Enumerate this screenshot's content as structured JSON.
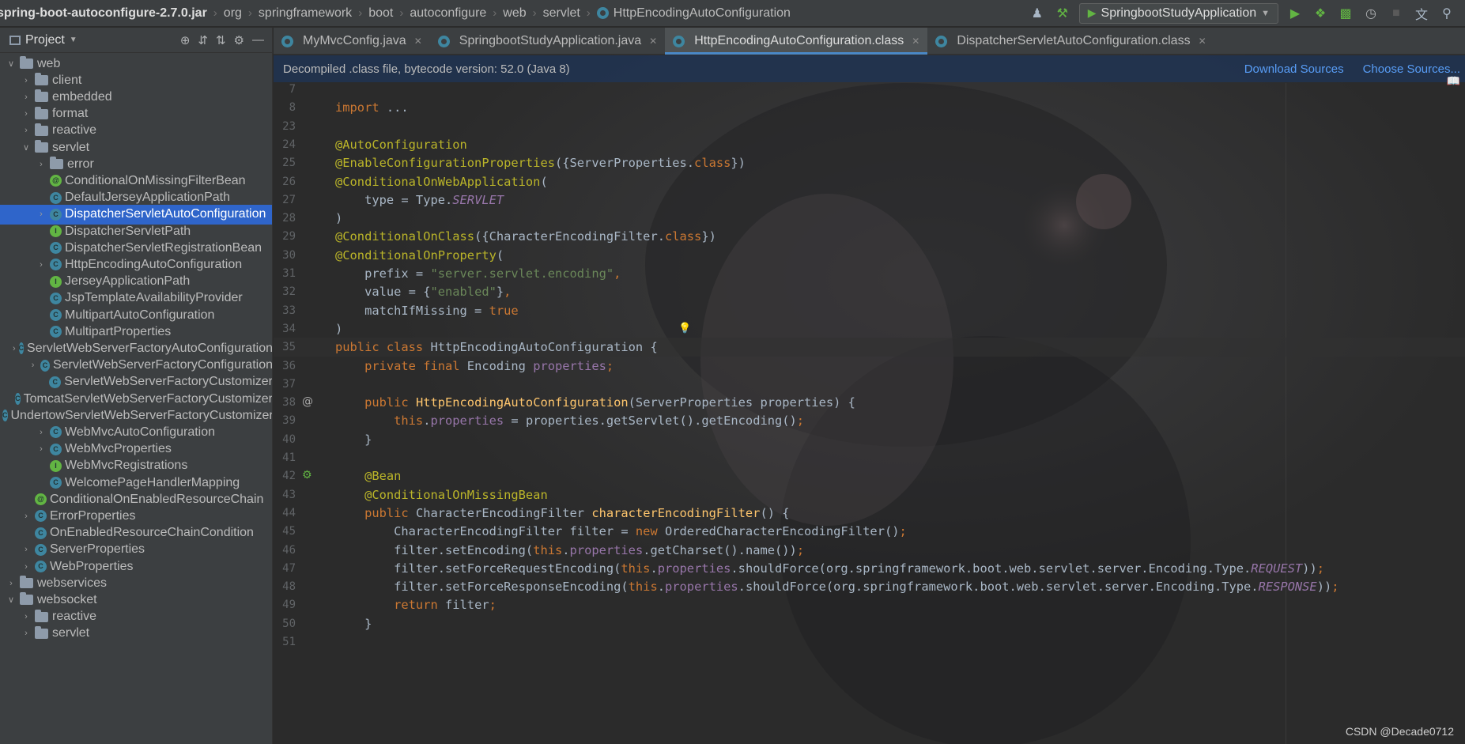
{
  "navbar": {
    "breadcrumb": [
      "spring-boot-autoconfigure-2.7.0.jar",
      "org",
      "springframework",
      "boot",
      "autoconfigure",
      "web",
      "servlet",
      "HttpEncodingAutoConfiguration"
    ],
    "run_config": "SpringbootStudyApplication",
    "icons": [
      "user-icon",
      "build-hammer-icon",
      "run-icon",
      "debug-icon",
      "coverage-icon",
      "profile-icon",
      "stop-icon",
      "translate-icon",
      "search-icon"
    ]
  },
  "project": {
    "title": "Project",
    "tree": [
      {
        "label": "web",
        "kind": "folder",
        "expanded": true
      },
      {
        "label": "client",
        "kind": "folder"
      },
      {
        "label": "embedded",
        "kind": "folder"
      },
      {
        "label": "format",
        "kind": "folder"
      },
      {
        "label": "reactive",
        "kind": "folder"
      },
      {
        "label": "servlet",
        "kind": "folder",
        "expanded": true
      },
      {
        "label": "error",
        "kind": "folder"
      },
      {
        "label": "ConditionalOnMissingFilterBean",
        "kind": "annotation"
      },
      {
        "label": "DefaultJerseyApplicationPath",
        "kind": "class"
      },
      {
        "label": "DispatcherServletAutoConfiguration",
        "kind": "class",
        "selected": true
      },
      {
        "label": "DispatcherServletPath",
        "kind": "interface"
      },
      {
        "label": "DispatcherServletRegistrationBean",
        "kind": "class"
      },
      {
        "label": "HttpEncodingAutoConfiguration",
        "kind": "class"
      },
      {
        "label": "JerseyApplicationPath",
        "kind": "interface"
      },
      {
        "label": "JspTemplateAvailabilityProvider",
        "kind": "class"
      },
      {
        "label": "MultipartAutoConfiguration",
        "kind": "class"
      },
      {
        "label": "MultipartProperties",
        "kind": "class"
      },
      {
        "label": "ServletWebServerFactoryAutoConfiguration",
        "kind": "class"
      },
      {
        "label": "ServletWebServerFactoryConfiguration",
        "kind": "class"
      },
      {
        "label": "ServletWebServerFactoryCustomizer",
        "kind": "class"
      },
      {
        "label": "TomcatServletWebServerFactoryCustomizer",
        "kind": "class"
      },
      {
        "label": "UndertowServletWebServerFactoryCustomizer",
        "kind": "class"
      },
      {
        "label": "WebMvcAutoConfiguration",
        "kind": "class"
      },
      {
        "label": "WebMvcProperties",
        "kind": "class"
      },
      {
        "label": "WebMvcRegistrations",
        "kind": "interface"
      },
      {
        "label": "WelcomePageHandlerMapping",
        "kind": "class"
      },
      {
        "label": "ConditionalOnEnabledResourceChain",
        "kind": "annotation"
      },
      {
        "label": "ErrorProperties",
        "kind": "class"
      },
      {
        "label": "OnEnabledResourceChainCondition",
        "kind": "class"
      },
      {
        "label": "ServerProperties",
        "kind": "class"
      },
      {
        "label": "WebProperties",
        "kind": "class"
      },
      {
        "label": "webservices",
        "kind": "folder"
      },
      {
        "label": "websocket",
        "kind": "folder",
        "expanded": true
      },
      {
        "label": "reactive",
        "kind": "folder"
      },
      {
        "label": "servlet",
        "kind": "folder"
      }
    ]
  },
  "tabs": [
    {
      "label": "MyMvcConfig.java"
    },
    {
      "label": "SpringbootStudyApplication.java"
    },
    {
      "label": "HttpEncodingAutoConfiguration.class",
      "active": true
    },
    {
      "label": "DispatcherServletAutoConfiguration.class"
    }
  ],
  "banner": {
    "message": "Decompiled .class file, bytecode version: 52.0 (Java 8)",
    "download": "Download Sources",
    "choose": "Choose Sources..."
  },
  "code": {
    "line_numbers": [
      "7",
      "8",
      "23",
      "24",
      "25",
      "26",
      "27",
      "28",
      "29",
      "30",
      "31",
      "32",
      "33",
      "34",
      "35",
      "36",
      "37",
      "38",
      "39",
      "40",
      "41",
      "42",
      "43",
      "44",
      "45",
      "46",
      "47",
      "48",
      "49",
      "50",
      "51"
    ],
    "lines": [
      [],
      [
        [
          "k",
          "import "
        ],
        [
          "p",
          "..."
        ]
      ],
      [],
      [
        [
          "an",
          "@AutoConfiguration"
        ]
      ],
      [
        [
          "an",
          "@EnableConfigurationProperties"
        ],
        [
          "p",
          "({ServerProperties."
        ],
        [
          "k",
          "class"
        ],
        [
          "p",
          "})"
        ]
      ],
      [
        [
          "an",
          "@ConditionalOnWebApplication"
        ],
        [
          "p",
          "("
        ]
      ],
      [
        [
          "p",
          "    type = Type."
        ],
        [
          "st",
          "SERVLET"
        ]
      ],
      [
        [
          "p",
          ")"
        ]
      ],
      [
        [
          "an",
          "@ConditionalOnClass"
        ],
        [
          "p",
          "({CharacterEncodingFilter."
        ],
        [
          "k",
          "class"
        ],
        [
          "p",
          "})"
        ]
      ],
      [
        [
          "an",
          "@ConditionalOnProperty"
        ],
        [
          "p",
          "("
        ]
      ],
      [
        [
          "p",
          "    prefix = "
        ],
        [
          "s",
          "\"server.servlet.encoding\""
        ],
        [
          "k",
          ","
        ]
      ],
      [
        [
          "p",
          "    value = {"
        ],
        [
          "s",
          "\"enabled\""
        ],
        [
          "p",
          "}"
        ],
        [
          "k",
          ","
        ]
      ],
      [
        [
          "p",
          "    matchIfMissing = "
        ],
        [
          "k",
          "true"
        ]
      ],
      [
        [
          "p",
          ")"
        ]
      ],
      [
        [
          "k",
          "public class "
        ],
        [
          "p",
          "HttpEncodingAutoConfiguration {"
        ]
      ],
      [
        [
          "k",
          "    private final "
        ],
        [
          "p",
          "Encoding "
        ],
        [
          "f",
          "properties"
        ],
        [
          "k",
          ";"
        ]
      ],
      [],
      [
        [
          "k",
          "    public "
        ],
        [
          "m",
          "HttpEncodingAutoConfiguration"
        ],
        [
          "p",
          "(ServerProperties properties) {"
        ]
      ],
      [
        [
          "k",
          "        this"
        ],
        [
          "p",
          "."
        ],
        [
          "f",
          "properties"
        ],
        [
          "p",
          " = properties.getServlet().getEncoding()"
        ],
        [
          "k",
          ";"
        ]
      ],
      [
        [
          "p",
          "    }"
        ]
      ],
      [],
      [
        [
          "an",
          "    @Bean"
        ]
      ],
      [
        [
          "an",
          "    @ConditionalOnMissingBean"
        ]
      ],
      [
        [
          "k",
          "    public "
        ],
        [
          "p",
          "CharacterEncodingFilter "
        ],
        [
          "m",
          "characterEncodingFilter"
        ],
        [
          "p",
          "() {"
        ]
      ],
      [
        [
          "p",
          "        CharacterEncodingFilter filter = "
        ],
        [
          "k",
          "new "
        ],
        [
          "p",
          "OrderedCharacterEncodingFilter()"
        ],
        [
          "k",
          ";"
        ]
      ],
      [
        [
          "p",
          "        filter.setEncoding("
        ],
        [
          "k",
          "this"
        ],
        [
          "p",
          "."
        ],
        [
          "f",
          "properties"
        ],
        [
          "p",
          ".getCharset().name())"
        ],
        [
          "k",
          ";"
        ]
      ],
      [
        [
          "p",
          "        filter.setForceRequestEncoding("
        ],
        [
          "k",
          "this"
        ],
        [
          "p",
          "."
        ],
        [
          "f",
          "properties"
        ],
        [
          "p",
          ".shouldForce(org.springframework.boot.web.servlet.server.Encoding.Type."
        ],
        [
          "st",
          "REQUEST"
        ],
        [
          "p",
          "))"
        ],
        [
          "k",
          ";"
        ]
      ],
      [
        [
          "p",
          "        filter.setForceResponseEncoding("
        ],
        [
          "k",
          "this"
        ],
        [
          "p",
          "."
        ],
        [
          "f",
          "properties"
        ],
        [
          "p",
          ".shouldForce(org.springframework.boot.web.servlet.server.Encoding.Type."
        ],
        [
          "st",
          "RESPONSE"
        ],
        [
          "p",
          "))"
        ],
        [
          "k",
          ";"
        ]
      ],
      [
        [
          "k",
          "        return "
        ],
        [
          "p",
          "filter"
        ],
        [
          "k",
          ";"
        ]
      ],
      [
        [
          "p",
          "    }"
        ]
      ],
      []
    ]
  },
  "watermark": "CSDN @Decade0712"
}
